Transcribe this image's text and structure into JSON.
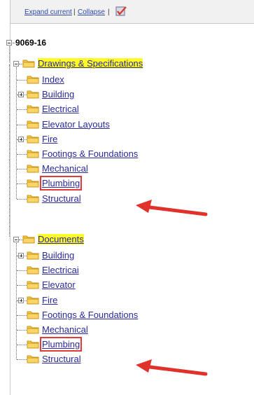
{
  "toolbar": {
    "expand_label": "Expand current",
    "collapse_label": "Collapse",
    "sep": "|"
  },
  "tree": {
    "root": "9069-16",
    "groups": [
      {
        "label": "Drawings & Specifications",
        "children": [
          "Index",
          "Building",
          "Electrical",
          "Elevator Layouts",
          "Fire",
          "Footings & Foundations",
          "Mechanical",
          "Plumbing",
          "Structural"
        ]
      },
      {
        "label": "Documents",
        "children": [
          "Building",
          "Electricai",
          "Elevator",
          "Fire",
          "Footings & Foundations",
          "Mechanical",
          "Plumbing",
          "Structural"
        ]
      }
    ]
  },
  "colors": {
    "highlight": "#fffb2a",
    "annotation": "#e23a3a",
    "link": "#2a2a9c"
  }
}
